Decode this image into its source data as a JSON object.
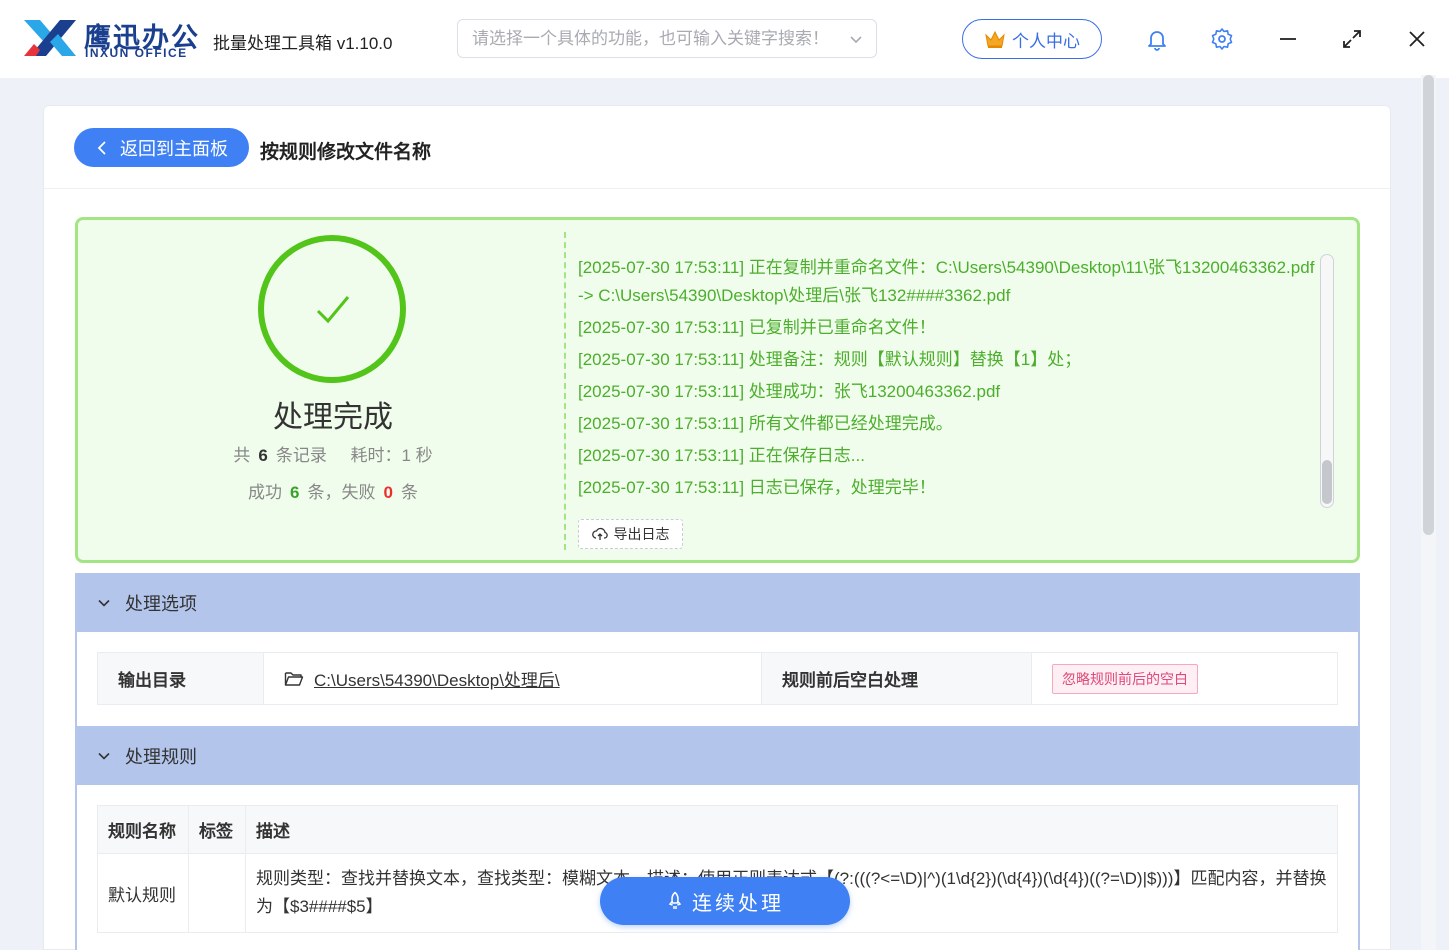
{
  "app": {
    "logo_cn": "鹰迅办公",
    "logo_en": "INXUN OFFICE",
    "title": "批量处理工具箱 v1.10.0",
    "brand_color": "#3f80f4"
  },
  "search": {
    "placeholder": "请选择一个具体的功能，也可输入关键字搜索！",
    "value": ""
  },
  "user_center": {
    "label": "个人中心",
    "icon": "crown-icon"
  },
  "window_controls": [
    "bell-icon",
    "gear-icon",
    "minimize-icon",
    "maximize-icon",
    "close-icon"
  ],
  "header": {
    "back_label": "返回到主面板",
    "page_title": "按规则修改文件名称"
  },
  "result": {
    "status": "处理完成",
    "total_prefix": "共",
    "total": "6",
    "total_suffix": "条记录",
    "time_label": "耗时：",
    "time_value": "1 秒",
    "success_prefix": "成功",
    "success": "6",
    "success_suffix": "条，失败",
    "fail": "0",
    "fail_suffix": "条",
    "log": [
      "[2025-07-30 17:53:11] 正在复制并重命名文件：C:\\Users\\54390\\Desktop\\11\\张飞13200463362.pdf -> C:\\Users\\54390\\Desktop\\处理后\\张飞132####3362.pdf",
      "[2025-07-30 17:53:11] 已复制并已重命名文件！",
      "[2025-07-30 17:53:11] 处理备注：规则【默认规则】替换【1】处；",
      "[2025-07-30 17:53:11] 处理成功：张飞13200463362.pdf",
      "[2025-07-30 17:53:11] 所有文件都已经处理完成。",
      "[2025-07-30 17:53:11] 正在保存日志...",
      "[2025-07-30 17:53:11] 日志已保存，处理完毕！"
    ],
    "export_label": "导出日志"
  },
  "options": {
    "title": "处理选项",
    "output_label": "输出目录",
    "output_path": "C:\\Users\\54390\\Desktop\\处理后\\",
    "whitespace_label": "规则前后空白处理",
    "whitespace_value": "忽略规则前后的空白"
  },
  "rules": {
    "title": "处理规则",
    "columns": [
      "规则名称",
      "标签",
      "描述"
    ],
    "rows": [
      {
        "name": "默认规则",
        "tag": "",
        "desc": "规则类型：查找并替换文本，查找类型：模糊文本，描述：使用正则表达式【(?:(((?<=\\D)|^)(1\\d{2})(\\d{4})(\\d{4})((?=\\D)|$)))】匹配内容，并替换为【$3####$5】"
      }
    ]
  },
  "continue_label": "连续处理"
}
